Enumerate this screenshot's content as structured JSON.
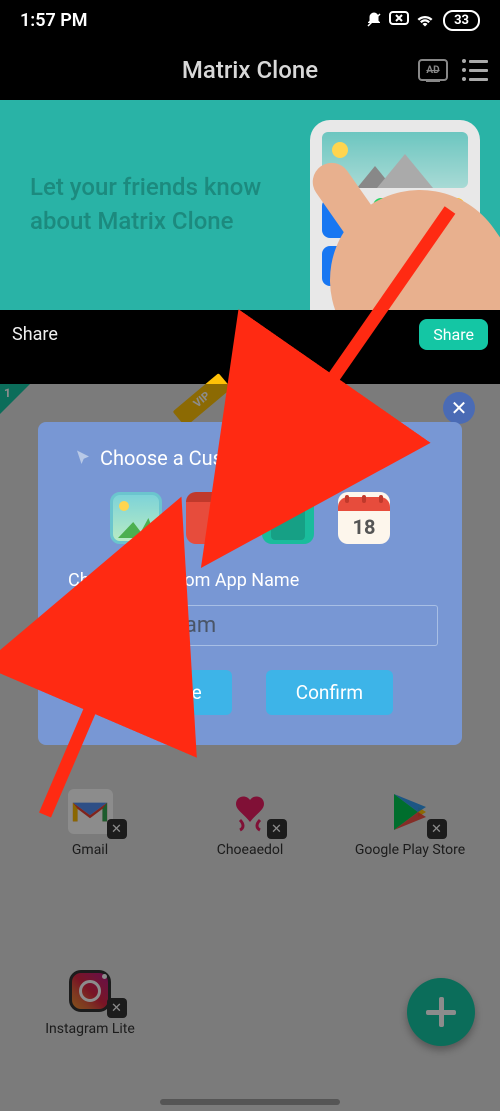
{
  "status": {
    "time": "1:57 PM",
    "battery": "33"
  },
  "header": {
    "title": "Matrix Clone"
  },
  "banner": {
    "text": "Let your friends know about Matrix Clone"
  },
  "share_bar": {
    "label": "Share",
    "button": "Share"
  },
  "grid_corner_tag": "1",
  "vip_label": "VIP",
  "apps": [
    {
      "label": "Gmail"
    },
    {
      "label": "Choeaedol"
    },
    {
      "label": "Google Play Store"
    },
    {
      "label": "Instagram Lite"
    }
  ],
  "modal": {
    "title": "Choose a Custom Icon",
    "subtitle": "Choose a Custom App Name",
    "input_value": "NewInstagram",
    "calendar_day": "18",
    "restore": "Restore",
    "confirm": "Confirm"
  }
}
